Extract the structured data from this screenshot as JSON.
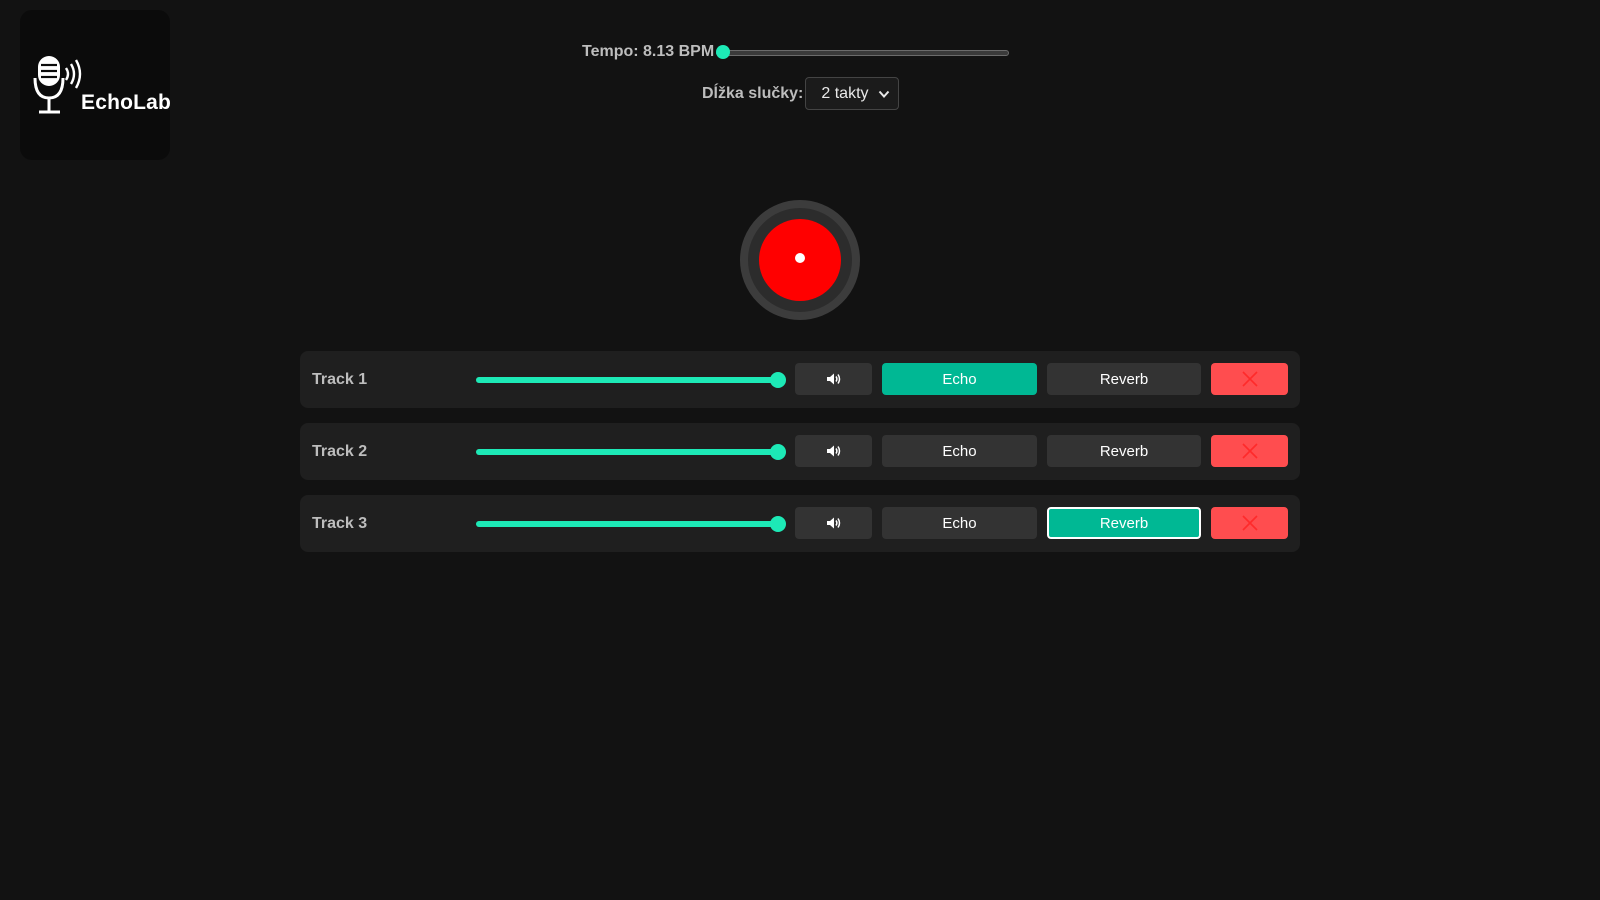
{
  "app": {
    "name": "EchoLab"
  },
  "tempo": {
    "label": "Tempo: 8.13 BPM",
    "slider_fraction": 0.0
  },
  "loop_length": {
    "label": "Dĺžka slučky:",
    "selected": "2 takty"
  },
  "tracks": [
    {
      "name": "Track 1",
      "volume_fraction": 1.0,
      "echo_label": "Echo",
      "reverb_label": "Reverb",
      "echo_active": true,
      "reverb_active": false
    },
    {
      "name": "Track 2",
      "volume_fraction": 1.0,
      "echo_label": "Echo",
      "reverb_label": "Reverb",
      "echo_active": false,
      "reverb_active": false
    },
    {
      "name": "Track 3",
      "volume_fraction": 1.0,
      "echo_label": "Echo",
      "reverb_label": "Reverb",
      "echo_active": false,
      "reverb_active": true
    }
  ],
  "icons": {
    "logo": "microphone-waves-icon",
    "mute": "speaker-icon",
    "delete": "close-icon",
    "select": "chevron-down-icon",
    "record": "record-dot-icon"
  },
  "colors": {
    "accent": "#1de9b6",
    "active_button": "#00b894",
    "record": "#ff0000",
    "delete": "#ff4d4f",
    "background": "#121212"
  }
}
